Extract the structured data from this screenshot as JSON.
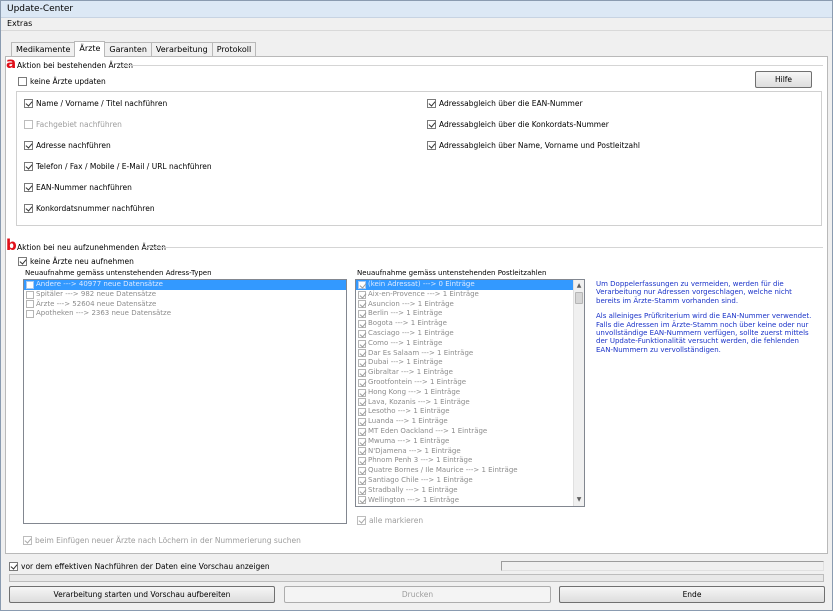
{
  "window": {
    "title": "Update-Center"
  },
  "menu": {
    "extras": "Extras"
  },
  "tabs": [
    {
      "label": "Medikamente",
      "active": false
    },
    {
      "label": "Ärzte",
      "active": true
    },
    {
      "label": "Garanten",
      "active": false
    },
    {
      "label": "Verarbeitung",
      "active": false
    },
    {
      "label": "Protokoll",
      "active": false
    }
  ],
  "markers": {
    "a": "a",
    "b": "b"
  },
  "section_a": {
    "title": "Aktion bei bestehenden Ärzten",
    "no_update_label": "keine Ärzte updaten",
    "help_button": "Hilfe",
    "left_options": [
      {
        "label": "Name / Vorname / Titel nachführen",
        "checked": true,
        "disabled": false
      },
      {
        "label": "Fachgebiet nachführen",
        "checked": false,
        "disabled": true
      },
      {
        "label": "Adresse nachführen",
        "checked": true,
        "disabled": false
      },
      {
        "label": "Telefon / Fax / Mobile / E-Mail / URL nachführen",
        "checked": true,
        "disabled": false
      },
      {
        "label": "EAN-Nummer nachführen",
        "checked": true,
        "disabled": false
      },
      {
        "label": "Konkordatsnummer nachführen",
        "checked": true,
        "disabled": false
      }
    ],
    "right_options": [
      {
        "label": "Adressabgleich über die EAN-Nummer",
        "checked": true
      },
      {
        "label": "Adressabgleich über die Konkordats-Nummer",
        "checked": true
      },
      {
        "label": "Adressabgleich über Name, Vorname und Postleitzahl",
        "checked": true
      }
    ]
  },
  "section_b": {
    "title": "Aktion bei neu aufzunehmenden Ärzten",
    "no_new_label": "keine Ärzte neu aufnehmen",
    "address_types_label": "Neuaufnahme gemäss untenstehenden Adress-Typen",
    "address_types": [
      {
        "label": "Andere  ---> 40977 neue Datensätze",
        "checked": false,
        "selected": true
      },
      {
        "label": "Spitäler  ---> 982 neue Datensätze",
        "checked": false,
        "selected": false
      },
      {
        "label": "Ärzte  ---> 52604 neue Datensätze",
        "checked": false,
        "selected": false
      },
      {
        "label": "Apotheken  ---> 2363 neue Datensätze",
        "checked": false,
        "selected": false
      }
    ],
    "postcodes_label": "Neuaufnahme gemäss untenstehenden Postleitzahlen",
    "postcodes": [
      {
        "label": "(kein Adressat)  ---> 0 Einträge",
        "checked": true,
        "selected": true
      },
      {
        "label": "Aix-en-Provence  ---> 1 Einträge",
        "checked": true
      },
      {
        "label": "Asuncion  ---> 1 Einträge",
        "checked": true
      },
      {
        "label": "Berlin  ---> 1 Einträge",
        "checked": true
      },
      {
        "label": "Bogota  ---> 1 Einträge",
        "checked": true
      },
      {
        "label": "Casciago  ---> 1 Einträge",
        "checked": true
      },
      {
        "label": "Como  ---> 1 Einträge",
        "checked": true
      },
      {
        "label": "Dar Es Salaam  ---> 1 Einträge",
        "checked": true
      },
      {
        "label": "Dubai  ---> 1 Einträge",
        "checked": true
      },
      {
        "label": "Gibraltar  ---> 1 Einträge",
        "checked": true
      },
      {
        "label": "Grootfontein  ---> 1 Einträge",
        "checked": true
      },
      {
        "label": "Hong Kong  ---> 1 Einträge",
        "checked": true
      },
      {
        "label": "Lava, Kozanis  ---> 1 Einträge",
        "checked": true
      },
      {
        "label": "Lesotho  ---> 1 Einträge",
        "checked": true
      },
      {
        "label": "Luanda  ---> 1 Einträge",
        "checked": true
      },
      {
        "label": "MT Eden Oackland  ---> 1 Einträge",
        "checked": true
      },
      {
        "label": "Mwuma  ---> 1 Einträge",
        "checked": true
      },
      {
        "label": "N'Djamena  ---> 1 Einträge",
        "checked": true
      },
      {
        "label": "Phnom Penh 3  ---> 1 Einträge",
        "checked": true
      },
      {
        "label": "Quatre Bornes / Ile Maurice  ---> 1 Einträge",
        "checked": true
      },
      {
        "label": "Santiago Chile  ---> 1 Einträge",
        "checked": true
      },
      {
        "label": "Stradbally  ---> 1 Einträge",
        "checked": true
      },
      {
        "label": "Wellington  ---> 1 Einträge",
        "checked": true
      }
    ],
    "select_all_label": "alle markieren",
    "holes_label": "beim Einfügen neuer Ärzte nach Löchern in der Nummerierung suchen",
    "info_paragraph_1": "Um Doppelerfassungen zu vermeiden, werden für die Verarbeitung nur Adressen vorgeschlagen, welche nicht bereits im Ärzte-Stamm vorhanden sind.",
    "info_paragraph_2": "Als alleiniges Prüfkriterium wird die EAN-Nummer verwendet. Falls die Adressen im Ärzte-Stamm noch über keine oder nur unvollständige EAN-Nummern verfügen, sollte zuerst mittels der Update-Funktionalität versucht werden, die fehlenden EAN-Nummern zu vervollständigen."
  },
  "footer": {
    "preview_label": "vor dem effektiven Nachführen der Daten eine Vorschau anzeigen",
    "start_button": "Verarbeitung starten und Vorschau aufbereiten",
    "print_button": "Drucken",
    "end_button": "Ende"
  }
}
